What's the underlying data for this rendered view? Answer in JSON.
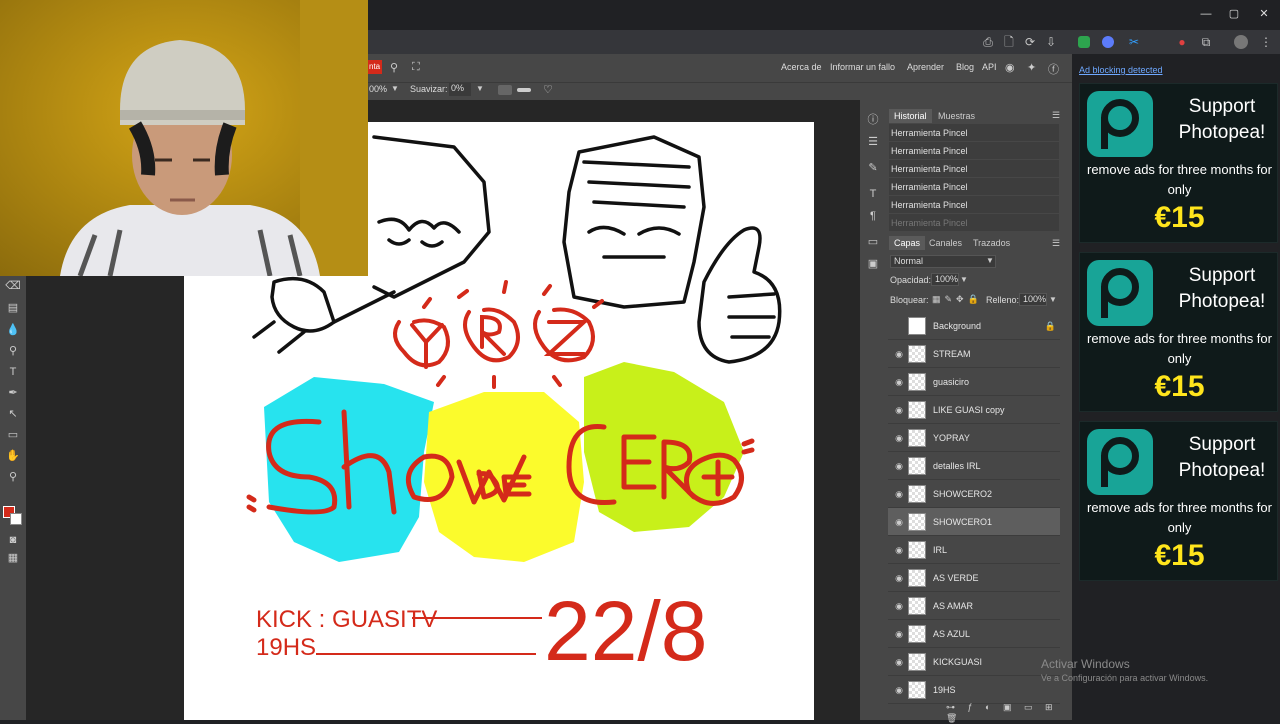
{
  "browser": {
    "window_controls": [
      "—",
      "▢",
      "✕"
    ],
    "toolbar_icons": [
      "⎙",
      "🗋",
      "⟳",
      "⇩",
      "★",
      "f"
    ]
  },
  "menu": {
    "links": [
      "Acerca de",
      "Informar un fallo",
      "Aprender",
      "Blog",
      "API"
    ],
    "active_label": "nta"
  },
  "options": {
    "opacity_value": "00%",
    "smooth_label": "Suavizar:",
    "smooth_value": "0%"
  },
  "history_panel": {
    "tabs": [
      "Historial",
      "Muestras"
    ],
    "rows": [
      "Herramienta Pincel",
      "Herramienta Pincel",
      "Herramienta Pincel",
      "Herramienta Pincel",
      "Herramienta Pincel",
      "Herramienta Pincel"
    ]
  },
  "layers_panel": {
    "tabs": [
      "Capas",
      "Canales",
      "Trazados"
    ],
    "blend_mode": "Normal",
    "opacity_label": "Opacidad:",
    "opacity_value": "100%",
    "lock_label": "Bloquear:",
    "fill_label": "Relleno:",
    "fill_value": "100%",
    "layers": [
      "Background",
      "STREAM",
      "guasiciro",
      "LIKE GUASI copy",
      "YOPRAY",
      "detalles IRL",
      "SHOWCERO2",
      "SHOWCERO1",
      "IRL",
      "AS VERDE",
      "AS AMAR",
      "AS AZUL",
      "KICKGUASI",
      "19HS"
    ],
    "selected_layer": "SHOWCERO1"
  },
  "canvas_text": {
    "kick_line": "KICK : GUASITV",
    "hour_line": "19HS",
    "date": "22/8",
    "logo_letters": "YRZ",
    "title_left": "Sho",
    "title_mid": "DE",
    "title_right": "CeRo"
  },
  "ads": {
    "warning": "Ad blocking detected",
    "items": [
      {
        "title": "Support Photopea!",
        "subtitle": "remove ads for three months for only",
        "price": "€15"
      },
      {
        "title": "Support Photopea!",
        "subtitle": "remove ads for three months for only",
        "price": "€15"
      },
      {
        "title": "Support Photopea!",
        "subtitle": "remove ads for three months for only",
        "price": "€15"
      }
    ]
  },
  "watermark": {
    "title": "Activar Windows",
    "subtitle": "Ve a Configuración para activar Windows."
  },
  "colors": {
    "accent_red": "#d42a1a",
    "ad_teal": "#18a497",
    "ad_price": "#ffe51c",
    "panel_bg": "#474747"
  }
}
